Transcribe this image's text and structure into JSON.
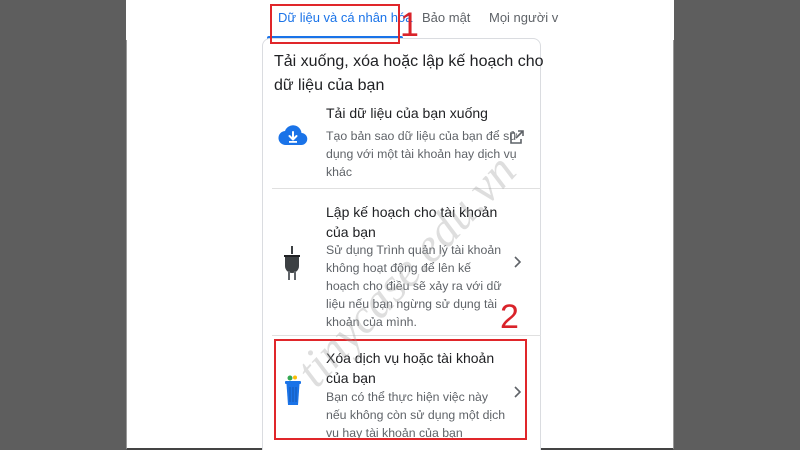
{
  "tabs": [
    {
      "label": "Dữ liệu và cá nhân hóa"
    },
    {
      "label": "Bảo mật"
    },
    {
      "label": "Mọi người v"
    }
  ],
  "annotations": {
    "step1": "1",
    "step2": "2"
  },
  "section": {
    "title": "Tải xuống, xóa hoặc lập kế hoạch cho dữ liệu của bạn",
    "items": [
      {
        "title": "Tải dữ liệu của bạn xuống",
        "description": "Tạo bản sao dữ liệu của bạn để sử dụng với một tài khoản hay dịch vụ khác",
        "icon": "cloud-download-icon",
        "action_icon": "open-in-new-icon"
      },
      {
        "title": "Lập kế hoạch cho tài khoản của bạn",
        "description": "Sử dụng Trình quản lý tài khoản không hoạt động để lên kế hoạch cho điều sẽ xảy ra với dữ liệu nếu bạn ngừng sử dụng tài khoản của mình.",
        "icon": "plug-icon",
        "action_icon": "chevron-right-icon"
      },
      {
        "title": "Xóa dịch vụ hoặc tài khoản của bạn",
        "description": "Bạn có thể thực hiện việc này nếu không còn sử dụng một dịch vụ hay tài khoản của bạn",
        "icon": "trash-can-icon",
        "action_icon": "chevron-right-icon"
      }
    ]
  },
  "watermark": "tinycase.edu.vn",
  "colors": {
    "accent": "#1a73e8",
    "callout": "#e0262a",
    "background": "#5e5e5e"
  }
}
